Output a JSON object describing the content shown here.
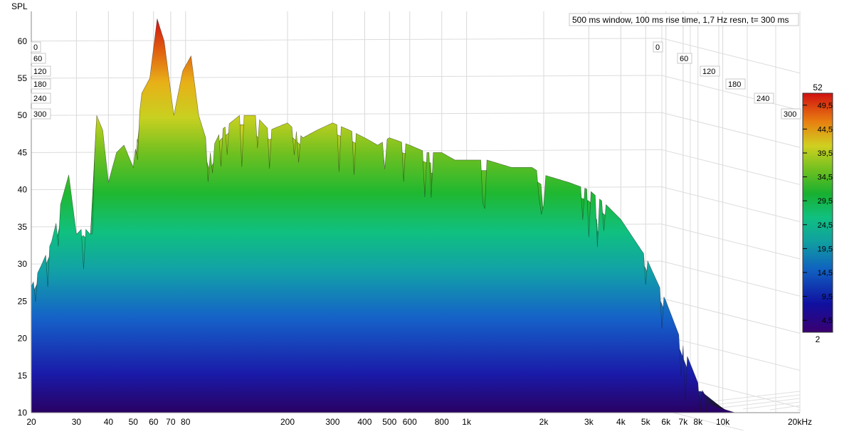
{
  "chart_data": {
    "type": "waterfall",
    "ylabel": "SPL",
    "info_label": "500 ms window, 100 ms rise time,  1,7 Hz resn, t= 300 ms",
    "x_ticks": [
      {
        "f": 20,
        "label": "20"
      },
      {
        "f": 30,
        "label": "30"
      },
      {
        "f": 40,
        "label": "40"
      },
      {
        "f": 50,
        "label": "50"
      },
      {
        "f": 60,
        "label": "60"
      },
      {
        "f": 70,
        "label": "70"
      },
      {
        "f": 80,
        "label": "80"
      },
      {
        "f": 200,
        "label": "200"
      },
      {
        "f": 300,
        "label": "300"
      },
      {
        "f": 400,
        "label": "400"
      },
      {
        "f": 500,
        "label": "500"
      },
      {
        "f": 600,
        "label": "600"
      },
      {
        "f": 800,
        "label": "800"
      },
      {
        "f": 1000,
        "label": "1k"
      },
      {
        "f": 2000,
        "label": "2k"
      },
      {
        "f": 3000,
        "label": "3k"
      },
      {
        "f": 4000,
        "label": "4k"
      },
      {
        "f": 5000,
        "label": "5k"
      },
      {
        "f": 6000,
        "label": "6k"
      },
      {
        "f": 7000,
        "label": "7k"
      },
      {
        "f": 8000,
        "label": "8k"
      },
      {
        "f": 10000,
        "label": "10k"
      },
      {
        "f": 20000,
        "label": "20kHz"
      }
    ],
    "xlim_hz": [
      20,
      20000
    ],
    "y_ticks": [
      10,
      15,
      20,
      25,
      30,
      35,
      40,
      45,
      50,
      55,
      60
    ],
    "ylim": [
      10,
      64
    ],
    "time_ticks_ms": [
      "0",
      "60",
      "120",
      "180",
      "240",
      "300"
    ],
    "colorbar": {
      "top_label": "52",
      "bottom_label": "2",
      "ticks": [
        "49,5",
        "44,5",
        "39,5",
        "34,5",
        "29,5",
        "24,5",
        "19,5",
        "14,5",
        "9,5",
        "4,5"
      ],
      "range": [
        2,
        52
      ]
    },
    "front_slice": {
      "time_ms": 0,
      "points": [
        [
          20,
          27
        ],
        [
          22,
          30
        ],
        [
          24,
          33
        ],
        [
          26,
          38
        ],
        [
          28,
          42
        ],
        [
          30,
          34
        ],
        [
          32,
          35
        ],
        [
          34,
          34
        ],
        [
          36,
          50
        ],
        [
          38,
          48
        ],
        [
          40,
          41
        ],
        [
          43,
          45
        ],
        [
          46,
          46
        ],
        [
          50,
          43
        ],
        [
          54,
          53
        ],
        [
          58,
          55
        ],
        [
          62,
          63
        ],
        [
          66,
          60
        ],
        [
          72,
          50
        ],
        [
          78,
          56
        ],
        [
          84,
          58
        ],
        [
          90,
          50
        ],
        [
          100,
          45
        ],
        [
          110,
          48
        ],
        [
          130,
          50
        ],
        [
          150,
          50
        ],
        [
          170,
          48
        ],
        [
          200,
          49
        ],
        [
          230,
          47
        ],
        [
          260,
          48
        ],
        [
          300,
          49
        ],
        [
          350,
          48
        ],
        [
          400,
          47
        ],
        [
          450,
          46
        ],
        [
          500,
          47
        ],
        [
          600,
          46
        ],
        [
          700,
          45
        ],
        [
          800,
          45
        ],
        [
          900,
          44
        ],
        [
          1000,
          44
        ],
        [
          1200,
          44
        ],
        [
          1500,
          43
        ],
        [
          1800,
          43
        ],
        [
          2000,
          42
        ],
        [
          2500,
          41
        ],
        [
          3000,
          40
        ],
        [
          3500,
          38
        ],
        [
          4000,
          36
        ],
        [
          5000,
          31
        ],
        [
          6000,
          25
        ],
        [
          7000,
          19
        ],
        [
          8000,
          14
        ],
        [
          9000,
          11
        ]
      ]
    },
    "decay_db_per_slice": 1.2,
    "slice_count": 30
  }
}
